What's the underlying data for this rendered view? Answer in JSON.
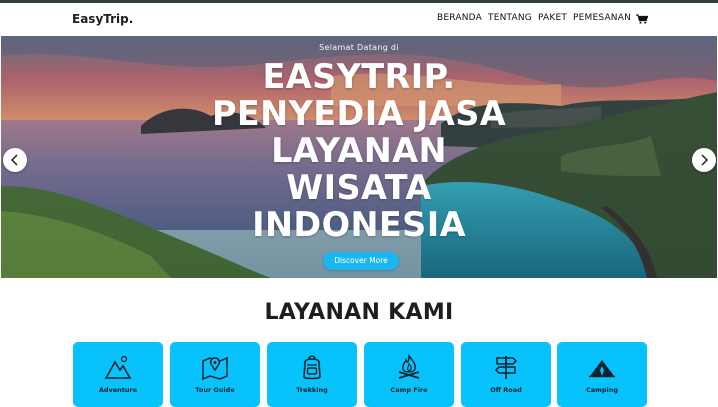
{
  "nav": {
    "brand": "EasyTrip.",
    "items": [
      {
        "label": "BERANDA"
      },
      {
        "label": "TENTANG"
      },
      {
        "label": "PAKET"
      },
      {
        "label": "PEMESANAN"
      }
    ],
    "cart_icon": "cart-icon"
  },
  "hero": {
    "subtitle": "Selamat Datang di",
    "title_lines": [
      "EASYTRIP.",
      "PENYEDIA JASA",
      "LAYANAN",
      "WISATA",
      "INDONESIA"
    ],
    "button_label": "Discover More",
    "prev_icon": "chevron-left-icon",
    "next_icon": "chevron-right-icon"
  },
  "services": {
    "title": "LAYANAN KAMI",
    "accent": "#08c3fb",
    "items": [
      {
        "label": "Adventure",
        "icon": "mountain-icon"
      },
      {
        "label": "Tour Guide",
        "icon": "map-icon"
      },
      {
        "label": "Trekking",
        "icon": "backpack-icon"
      },
      {
        "label": "Camp Fire",
        "icon": "campfire-icon"
      },
      {
        "label": "Off Road",
        "icon": "signpost-icon"
      },
      {
        "label": "Camping",
        "icon": "tent-icon"
      }
    ]
  }
}
